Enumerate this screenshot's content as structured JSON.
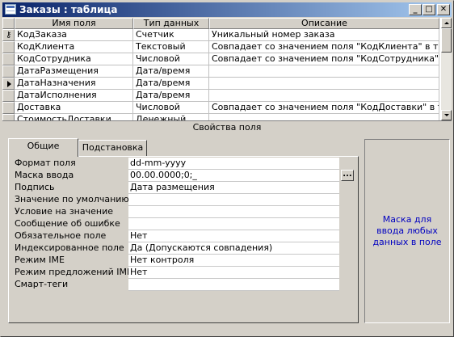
{
  "window": {
    "title": "Заказы : таблица",
    "buttons": {
      "minimize": "_",
      "maximize": "□",
      "close": "✕"
    }
  },
  "grid": {
    "columns": [
      "Имя поля",
      "Тип данных",
      "Описание"
    ],
    "rows": [
      {
        "name": "КодЗаказа",
        "type": "Счетчик",
        "description": "Уникальный номер заказа",
        "marker": "key"
      },
      {
        "name": "КодКлиента",
        "type": "Текстовый",
        "description": "Совпадает со значением поля \"КодКлиента\" в таблице",
        "marker": ""
      },
      {
        "name": "КодСотрудника",
        "type": "Числовой",
        "description": "Совпадает со значением поля \"КодСотрудника\" в табл",
        "marker": ""
      },
      {
        "name": "ДатаРазмещения",
        "type": "Дата/время",
        "description": "",
        "marker": ""
      },
      {
        "name": "ДатаНазначения",
        "type": "Дата/время",
        "description": "",
        "marker": "current"
      },
      {
        "name": "ДатаИсполнения",
        "type": "Дата/время",
        "description": "",
        "marker": ""
      },
      {
        "name": "Доставка",
        "type": "Числовой",
        "description": "Совпадает со значением поля \"КодДоставки\" в таблиц",
        "marker": ""
      },
      {
        "name": "СтоимостьДоставки",
        "type": "Денежный",
        "description": "",
        "marker": ""
      }
    ]
  },
  "properties": {
    "title": "Свойства поля",
    "tabs": [
      "Общие",
      "Подстановка"
    ],
    "active_tab": "Общие",
    "rows": [
      {
        "label": "Формат поля",
        "value": "dd-mm-yyyy"
      },
      {
        "label": "Маска ввода",
        "value": "00.00.0000;0;_"
      },
      {
        "label": "Подпись",
        "value": "Дата размещения"
      },
      {
        "label": "Значение по умолчанию",
        "value": ""
      },
      {
        "label": "Условие на значение",
        "value": ""
      },
      {
        "label": "Сообщение об ошибке",
        "value": ""
      },
      {
        "label": "Обязательное поле",
        "value": "Нет"
      },
      {
        "label": "Индексированное поле",
        "value": "Да (Допускаются совпадения)"
      },
      {
        "label": "Режим IME",
        "value": "Нет контроля"
      },
      {
        "label": "Режим предложений IME",
        "value": "Нет"
      },
      {
        "label": "Смарт-теги",
        "value": ""
      }
    ],
    "builder_button": "...",
    "hint": "Маска для ввода любых данных в поле"
  },
  "icons": {
    "key": "key-icon",
    "current_row": "row-pointer-icon"
  },
  "colors": {
    "title_gradient_start": "#0a246a",
    "title_gradient_end": "#a6caf0",
    "hint_text": "#0000c0",
    "face": "#d4d0c8"
  }
}
